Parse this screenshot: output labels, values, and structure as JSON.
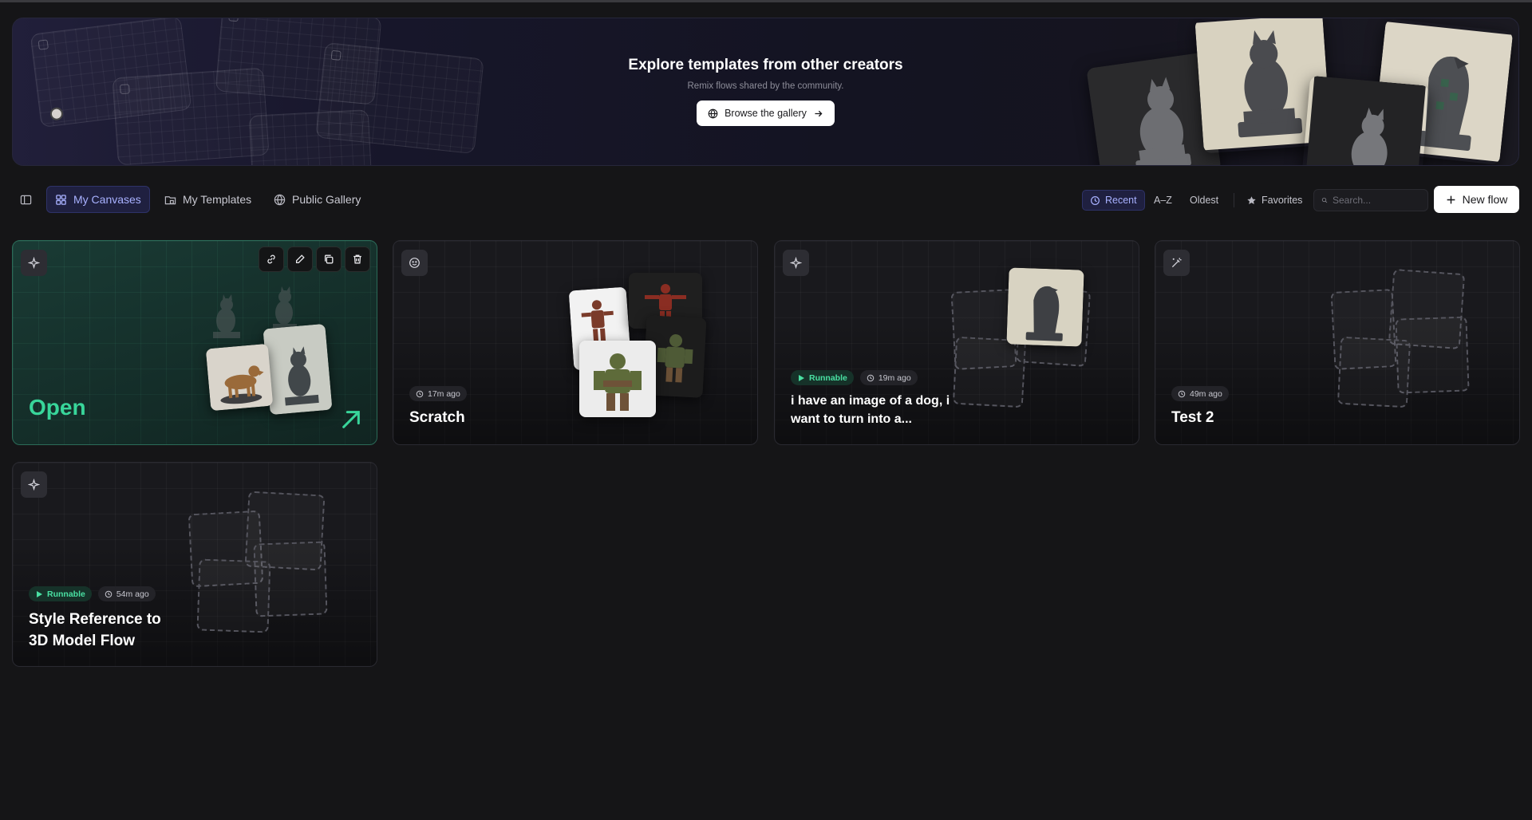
{
  "banner": {
    "title": "Explore templates from other creators",
    "subtitle": "Remix flows shared by the community.",
    "browse_label": "Browse the gallery"
  },
  "toolbar": {
    "tabs": [
      {
        "label": "My Canvases",
        "icon": "grid-icon",
        "active": true
      },
      {
        "label": "My Templates",
        "icon": "folder-icon",
        "active": false
      },
      {
        "label": "Public Gallery",
        "icon": "globe-icon",
        "active": false
      }
    ],
    "sort": [
      {
        "label": "Recent",
        "icon": "clock-icon",
        "active": true
      },
      {
        "label": "A–Z",
        "active": false
      },
      {
        "label": "Oldest",
        "active": false
      }
    ],
    "favorites_label": "Favorites",
    "search_placeholder": "Search...",
    "new_flow_label": "New flow"
  },
  "cards": [
    {
      "title": "Open",
      "state": "hover",
      "icon": "sparkle-icon"
    },
    {
      "title": "Scratch",
      "time": "17m ago",
      "icon": "smiley-icon"
    },
    {
      "title": "i have an image of a dog, i want to turn into a...",
      "badge": "Runnable",
      "time": "19m ago",
      "icon": "sparkle-icon"
    },
    {
      "title": "Test 2",
      "time": "49m ago",
      "icon": "wand-icon"
    },
    {
      "title": "Style Reference to 3D Model Flow",
      "badge": "Runnable",
      "time": "54m ago",
      "icon": "sparkle-icon"
    }
  ],
  "colors": {
    "accent": "#a8b1ff",
    "runnable": "#49e0a2",
    "open": "#38d59a"
  }
}
